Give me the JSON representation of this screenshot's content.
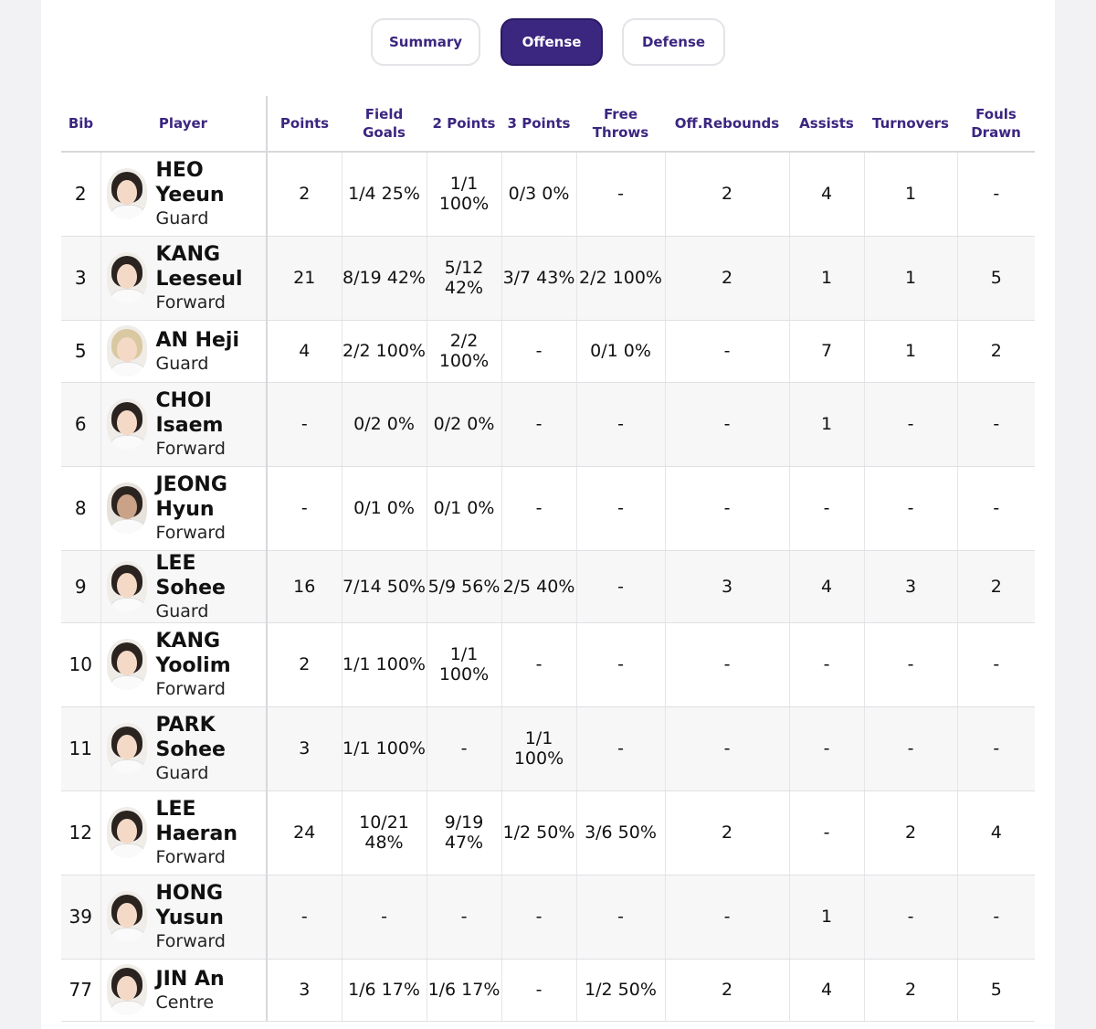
{
  "tabs": [
    {
      "label": "Summary",
      "active": false
    },
    {
      "label": "Offense",
      "active": true
    },
    {
      "label": "Defense",
      "active": false
    }
  ],
  "columns": [
    "Bib",
    "Player",
    "Points",
    "Field Goals",
    "2 Points",
    "3 Points",
    "Free Throws",
    "Off.Rebounds",
    "Assists",
    "Turnovers",
    "Fouls Drawn"
  ],
  "players": [
    {
      "bib": "2",
      "name": "HEO Yeeun",
      "pos": "Guard",
      "points": "2",
      "fg": "1/4 25%",
      "p2": "1/1 100%",
      "p3": "0/3 0%",
      "ft": "-",
      "oreb": "2",
      "ast": "4",
      "to": "1",
      "fd": "-"
    },
    {
      "bib": "3",
      "name": "KANG Leeseul",
      "pos": "Forward",
      "points": "21",
      "fg": "8/19 42%",
      "p2": "5/12 42%",
      "p3": "3/7 43%",
      "ft": "2/2 100%",
      "oreb": "2",
      "ast": "1",
      "to": "1",
      "fd": "5"
    },
    {
      "bib": "5",
      "name": "AN Heji",
      "pos": "Guard",
      "points": "4",
      "fg": "2/2 100%",
      "p2": "2/2 100%",
      "p3": "-",
      "ft": "0/1 0%",
      "oreb": "-",
      "ast": "7",
      "to": "1",
      "fd": "2"
    },
    {
      "bib": "6",
      "name": "CHOI Isaem",
      "pos": "Forward",
      "points": "-",
      "fg": "0/2 0%",
      "p2": "0/2 0%",
      "p3": "-",
      "ft": "-",
      "oreb": "-",
      "ast": "1",
      "to": "-",
      "fd": "-"
    },
    {
      "bib": "8",
      "name": "JEONG Hyun",
      "pos": "Forward",
      "points": "-",
      "fg": "0/1 0%",
      "p2": "0/1 0%",
      "p3": "-",
      "ft": "-",
      "oreb": "-",
      "ast": "-",
      "to": "-",
      "fd": "-"
    },
    {
      "bib": "9",
      "name": "LEE Sohee",
      "pos": "Guard",
      "points": "16",
      "fg": "7/14 50%",
      "p2": "5/9 56%",
      "p3": "2/5 40%",
      "ft": "-",
      "oreb": "3",
      "ast": "4",
      "to": "3",
      "fd": "2"
    },
    {
      "bib": "10",
      "name": "KANG Yoolim",
      "pos": "Forward",
      "points": "2",
      "fg": "1/1 100%",
      "p2": "1/1 100%",
      "p3": "-",
      "ft": "-",
      "oreb": "-",
      "ast": "-",
      "to": "-",
      "fd": "-"
    },
    {
      "bib": "11",
      "name": "PARK Sohee",
      "pos": "Guard",
      "points": "3",
      "fg": "1/1 100%",
      "p2": "-",
      "p3": "1/1 100%",
      "ft": "-",
      "oreb": "-",
      "ast": "-",
      "to": "-",
      "fd": "-"
    },
    {
      "bib": "12",
      "name": "LEE Haeran",
      "pos": "Forward",
      "points": "24",
      "fg": "10/21 48%",
      "p2": "9/19 47%",
      "p3": "1/2 50%",
      "ft": "3/6 50%",
      "oreb": "2",
      "ast": "-",
      "to": "2",
      "fd": "4"
    },
    {
      "bib": "39",
      "name": "HONG Yusun",
      "pos": "Forward",
      "points": "-",
      "fg": "-",
      "p2": "-",
      "p3": "-",
      "ft": "-",
      "oreb": "-",
      "ast": "1",
      "to": "-",
      "fd": "-"
    },
    {
      "bib": "77",
      "name": "JIN An",
      "pos": "Centre",
      "points": "3",
      "fg": "1/6 17%",
      "p2": "1/6 17%",
      "p3": "-",
      "ft": "1/2 50%",
      "oreb": "2",
      "ast": "4",
      "to": "2",
      "fd": "5"
    }
  ],
  "colors": {
    "accent": "#3b2680"
  }
}
